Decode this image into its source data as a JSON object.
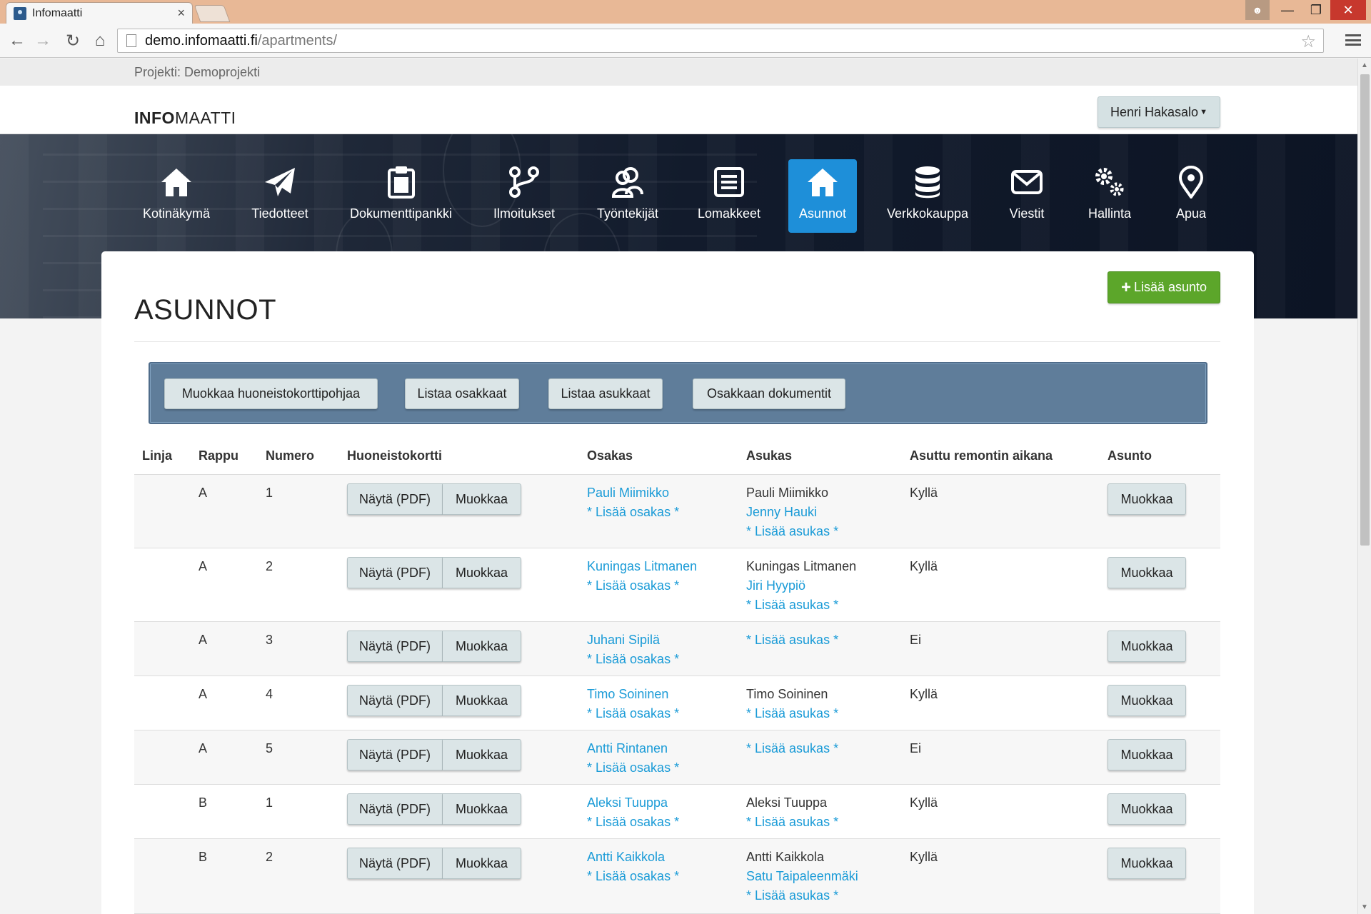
{
  "browser": {
    "tab_title": "Infomaatti",
    "url_host": "demo.infomaatti.fi",
    "url_path": "/apartments/"
  },
  "project": {
    "label": "Projekti: Demoprojekti"
  },
  "header": {
    "logo_bold": "INFO",
    "logo_rest": "MAATTI",
    "user_menu": "Henri Hakasalo"
  },
  "nav": [
    {
      "label": "Kotinäkymä",
      "icon": "home-icon"
    },
    {
      "label": "Tiedotteet",
      "icon": "paper-plane-icon"
    },
    {
      "label": "Dokumenttipankki",
      "icon": "clipboard-icon"
    },
    {
      "label": "Ilmoitukset",
      "icon": "branch-icon"
    },
    {
      "label": "Työntekijät",
      "icon": "users-icon"
    },
    {
      "label": "Lomakkeet",
      "icon": "form-icon"
    },
    {
      "label": "Asunnot",
      "icon": "home-icon",
      "active": true
    },
    {
      "label": "Verkkokauppa",
      "icon": "database-icon"
    },
    {
      "label": "Viestit",
      "icon": "envelope-icon"
    },
    {
      "label": "Hallinta",
      "icon": "gears-icon"
    },
    {
      "label": "Apua",
      "icon": "map-pin-icon"
    }
  ],
  "page": {
    "title": "ASUNNOT",
    "add_button": "Lisää asunto"
  },
  "actions": {
    "edit_template": "Muokkaa huoneistokorttipohjaa",
    "list_owners": "Listaa osakkaat",
    "list_residents": "Listaa asukkaat",
    "owner_documents": "Osakkaan dokumentit"
  },
  "table": {
    "headers": {
      "linja": "Linja",
      "rappu": "Rappu",
      "numero": "Numero",
      "huoneistokortti": "Huoneistokortti",
      "osakas": "Osakas",
      "asukas": "Asukas",
      "asuttu": "Asuttu remontin aikana",
      "asunto": "Asunto"
    },
    "btn_pdf": "Näytä (PDF)",
    "btn_edit": "Muokkaa",
    "add_owner": "* Lisää osakas *",
    "add_resident": "* Lisää asukas *",
    "rows": [
      {
        "rappu": "A",
        "numero": "1",
        "osakas": "Pauli Miimikko",
        "asukas_plain": "Pauli Miimikko",
        "asukas_links": [
          "Jenny Hauki"
        ],
        "asuttu": "Kyllä"
      },
      {
        "rappu": "A",
        "numero": "2",
        "osakas": "Kuningas Litmanen",
        "asukas_plain": "Kuningas Litmanen",
        "asukas_links": [
          "Jiri Hyypiö"
        ],
        "asuttu": "Kyllä"
      },
      {
        "rappu": "A",
        "numero": "3",
        "osakas": "Juhani Sipilä",
        "asukas_plain": "",
        "asukas_links": [],
        "asuttu": "Ei"
      },
      {
        "rappu": "A",
        "numero": "4",
        "osakas": "Timo Soininen",
        "asukas_plain": "Timo Soininen",
        "asukas_links": [],
        "asuttu": "Kyllä"
      },
      {
        "rappu": "A",
        "numero": "5",
        "osakas": "Antti Rintanen",
        "asukas_plain": "",
        "asukas_links": [],
        "asuttu": "Ei"
      },
      {
        "rappu": "B",
        "numero": "1",
        "osakas": "Aleksi Tuuppa",
        "asukas_plain": "Aleksi Tuuppa",
        "asukas_links": [],
        "asuttu": "Kyllä"
      },
      {
        "rappu": "B",
        "numero": "2",
        "osakas": "Antti Kaikkola",
        "asukas_plain": "Antti Kaikkola",
        "asukas_links": [
          "Satu Taipaleenmäki"
        ],
        "asuttu": "Kyllä"
      }
    ]
  },
  "colors": {
    "accent": "#1e8fd9",
    "link": "#1a9bd7",
    "success": "#5ca62a",
    "action_panel": "#5f7d9a"
  }
}
